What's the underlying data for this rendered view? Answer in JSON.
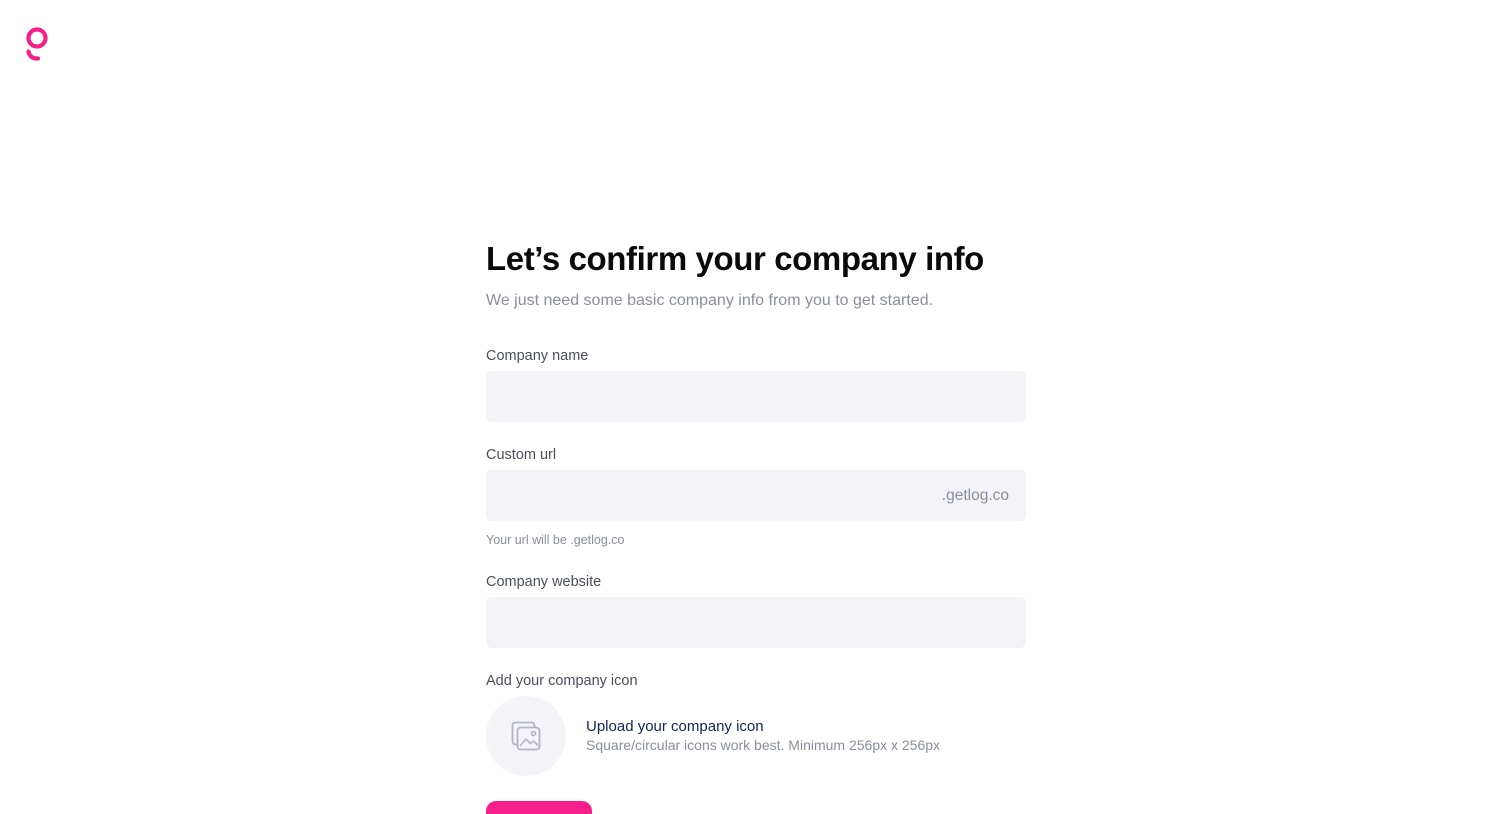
{
  "brand": {
    "logo_icon": "getlog-logo-icon",
    "accent_color": "#f7208a"
  },
  "header": {
    "title": "Let’s confirm your company info",
    "subtitle": "We just need some basic company info from you to get started."
  },
  "fields": {
    "company_name": {
      "label": "Company name",
      "value": "",
      "placeholder": ""
    },
    "custom_url": {
      "label": "Custom url",
      "value": "",
      "placeholder": "",
      "suffix": ".getlog.co",
      "helper": "Your url will be .getlog.co"
    },
    "company_website": {
      "label": "Company website",
      "value": "",
      "placeholder": ""
    }
  },
  "icon_upload": {
    "label": "Add your company icon",
    "icon": "image-placeholder-icon",
    "link_text": "Upload your company icon",
    "hint": "Square/circular icons work best. Minimum 256px x 256px"
  },
  "actions": {
    "continue_label": ""
  }
}
